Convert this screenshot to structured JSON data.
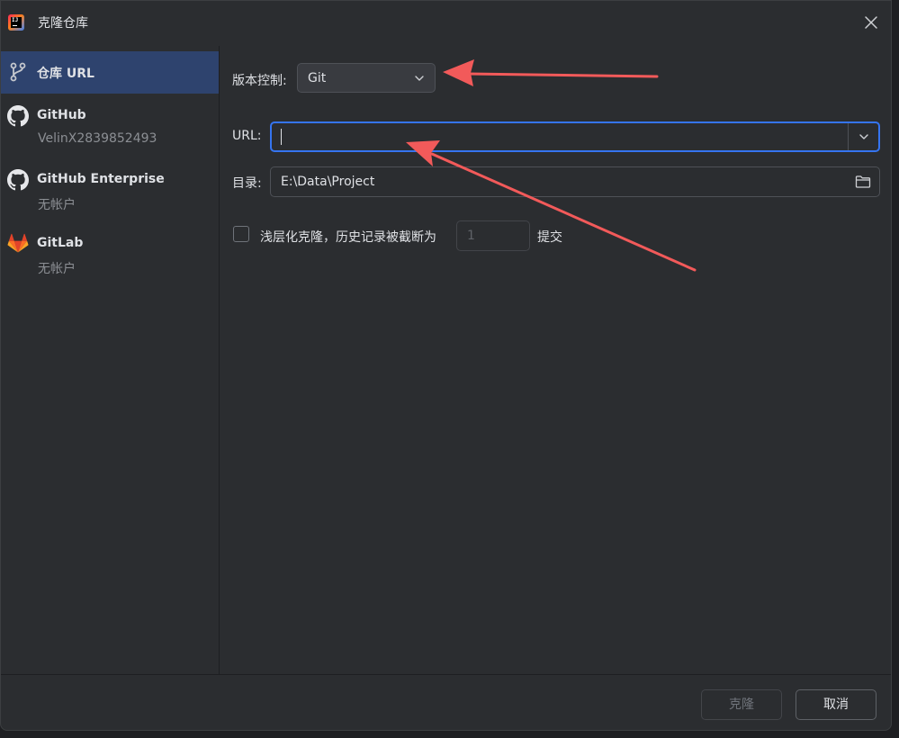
{
  "window": {
    "title": "克隆仓库",
    "app_icon": "intellij-idea-icon",
    "close_icon": "close-icon"
  },
  "sidebar": {
    "items": [
      {
        "label": "仓库 URL",
        "sub": "",
        "icon": "vcs-branch-icon",
        "selected": true
      },
      {
        "label": "GitHub",
        "sub": "VelinX2839852493",
        "icon": "github-icon",
        "selected": false
      },
      {
        "label": "GitHub Enterprise",
        "sub": "无帐户",
        "icon": "github-icon",
        "selected": false
      },
      {
        "label": "GitLab",
        "sub": "无帐户",
        "icon": "gitlab-icon",
        "selected": false
      }
    ]
  },
  "form": {
    "vcs_label": "版本控制:",
    "vcs_value": "Git",
    "url_label": "URL:",
    "url_value": "",
    "dir_label": "目录:",
    "dir_value": "E:\\Data\\Project",
    "shallow_label": "浅层化克隆，历史记录被截断为",
    "shallow_checked": false,
    "shallow_depth": "1",
    "shallow_suffix": "提交"
  },
  "footer": {
    "clone_label": "克隆",
    "cancel_label": "取消"
  },
  "colors": {
    "background": "#2b2d30",
    "selection": "#2e436e",
    "focus": "#3574f0",
    "annotation_arrow": "#f25a5a",
    "gitlab_orange": "#fc6d26"
  }
}
